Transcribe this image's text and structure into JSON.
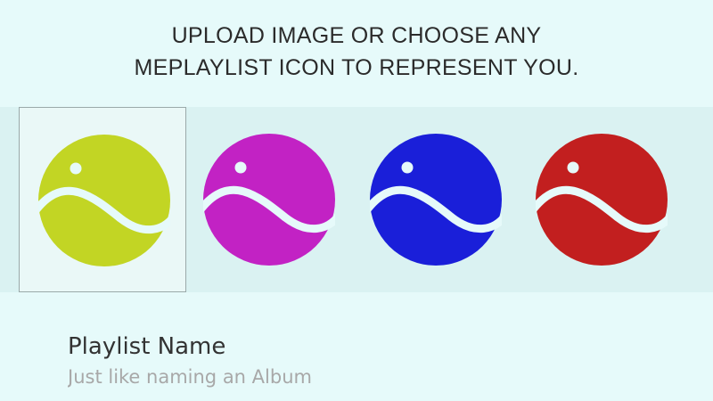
{
  "header": {
    "line1": "UPLOAD IMAGE OR CHOOSE ANY",
    "line2": "MEPLAYLIST ICON TO REPRESENT YOU."
  },
  "icons": [
    {
      "name": "meplaylist-icon",
      "color": "#c2d524",
      "selected": true
    },
    {
      "name": "meplaylist-icon",
      "color": "#c222c4",
      "selected": false
    },
    {
      "name": "meplaylist-icon",
      "color": "#1a1fd9",
      "selected": false
    },
    {
      "name": "meplaylist-icon",
      "color": "#c21f1f",
      "selected": false
    }
  ],
  "form": {
    "playlist_name_label": "Playlist Name",
    "playlist_name_placeholder": "Just like naming an Album"
  },
  "colors": {
    "background": "#e6fafa",
    "strip": "#daf2f2",
    "selected_cell": "#eaf8f7",
    "wave": "#e6fafa"
  }
}
